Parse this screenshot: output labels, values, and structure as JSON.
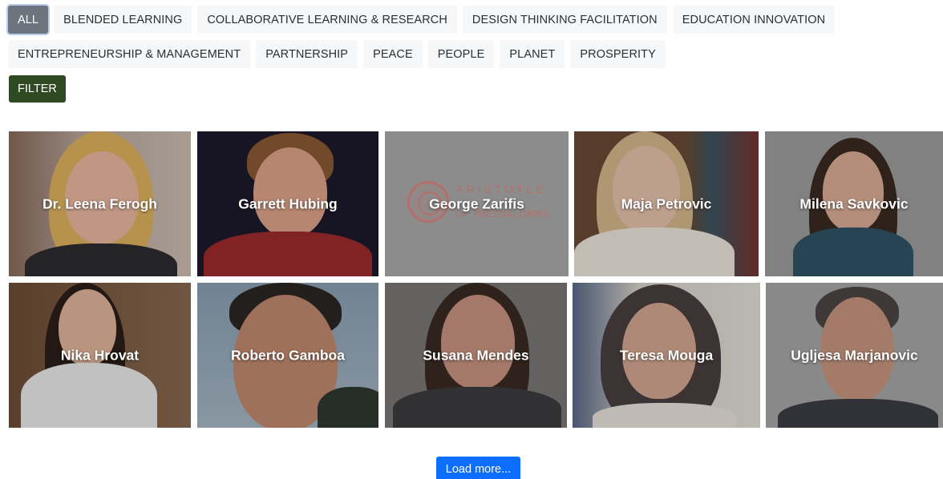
{
  "filters": {
    "row1": [
      "ALL",
      "BLENDED LEARNING",
      "COLLABORATIVE LEARNING & RESEARCH",
      "DESIGN THINKING FACILITATION",
      "EDUCATION INNOVATION"
    ],
    "row2": [
      "ENTREPRENEURSHIP & MANAGEMENT",
      "PARTNERSHIP",
      "PEACE",
      "PEOPLE",
      "PLANET",
      "PROSPERITY"
    ],
    "active": "ALL",
    "submit_label": "FILTER"
  },
  "people": [
    {
      "name": "Dr. Leena Ferogh"
    },
    {
      "name": "Garrett Hubing"
    },
    {
      "name": "George Zarifis",
      "logo_line1": "ARISTOTLE",
      "logo_line2": "OF THESSALONIKI"
    },
    {
      "name": "Maja Petrovic"
    },
    {
      "name": "Milena Savkovic"
    },
    {
      "name": "Nika Hrovat"
    },
    {
      "name": "Roberto Gamboa"
    },
    {
      "name": "Susana Mendes"
    },
    {
      "name": "Teresa Mouga"
    },
    {
      "name": "Ugljesa Marjanovic"
    }
  ],
  "load_more_label": "Load more...",
  "colors": {
    "active_chip": "#6c757d",
    "filter_button": "#2f4a23",
    "load_more_button": "#0d6efd"
  }
}
